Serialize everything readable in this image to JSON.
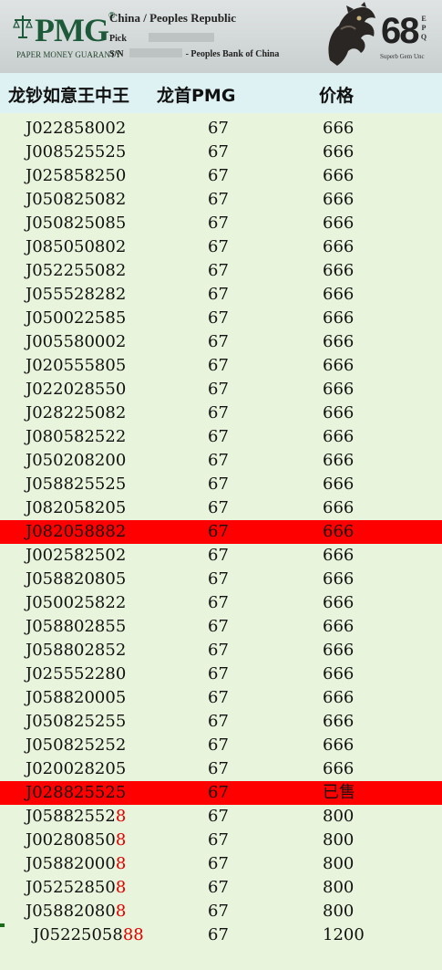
{
  "pmg": {
    "logo": "PMG",
    "tm": "®",
    "tagline": "PAPER MONEY GUARANTY",
    "country": "China / Peoples Republic",
    "pick_label": "Pick",
    "sn_label": "S/N",
    "bank": "- Peoples Bank of China",
    "grade": "68",
    "epq": [
      "E",
      "P",
      "Q"
    ],
    "grade_desc": "Superb Gem Unc"
  },
  "header": {
    "col_serial": "龙钞如意王中王",
    "col_grade": "龙首PMG",
    "col_price": "价格"
  },
  "rows": [
    {
      "serial": "J022858002",
      "suffix": "",
      "grade": "67",
      "price": "666",
      "highlight": false
    },
    {
      "serial": "J008525525",
      "suffix": "",
      "grade": "67",
      "price": "666",
      "highlight": false
    },
    {
      "serial": "J025858250",
      "suffix": "",
      "grade": "67",
      "price": "666",
      "highlight": false
    },
    {
      "serial": "J050825082",
      "suffix": "",
      "grade": "67",
      "price": "666",
      "highlight": false
    },
    {
      "serial": "J050825085",
      "suffix": "",
      "grade": "67",
      "price": "666",
      "highlight": false
    },
    {
      "serial": "J085050802",
      "suffix": "",
      "grade": "67",
      "price": "666",
      "highlight": false
    },
    {
      "serial": "J052255082",
      "suffix": "",
      "grade": "67",
      "price": "666",
      "highlight": false
    },
    {
      "serial": "J055528282",
      "suffix": "",
      "grade": "67",
      "price": "666",
      "highlight": false
    },
    {
      "serial": "J050022585",
      "suffix": "",
      "grade": "67",
      "price": "666",
      "highlight": false
    },
    {
      "serial": "J005580002",
      "suffix": "",
      "grade": "67",
      "price": "666",
      "highlight": false
    },
    {
      "serial": "J020555805",
      "suffix": "",
      "grade": "67",
      "price": "666",
      "highlight": false
    },
    {
      "serial": "J022028550",
      "suffix": "",
      "grade": "67",
      "price": "666",
      "highlight": false
    },
    {
      "serial": "J028225082",
      "suffix": "",
      "grade": "67",
      "price": "666",
      "highlight": false
    },
    {
      "serial": "J080582522",
      "suffix": "",
      "grade": "67",
      "price": "666",
      "highlight": false
    },
    {
      "serial": "J050208200",
      "suffix": "",
      "grade": "67",
      "price": "666",
      "highlight": false
    },
    {
      "serial": "J058825525",
      "suffix": "",
      "grade": "67",
      "price": "666",
      "highlight": false
    },
    {
      "serial": "J082058205",
      "suffix": "",
      "grade": "67",
      "price": "666",
      "highlight": false
    },
    {
      "serial": "J082058882",
      "suffix": "",
      "grade": "67",
      "price": "666",
      "highlight": true
    },
    {
      "serial": "J002582502",
      "suffix": "",
      "grade": "67",
      "price": "666",
      "highlight": false
    },
    {
      "serial": "J058820805",
      "suffix": "",
      "grade": "67",
      "price": "666",
      "highlight": false
    },
    {
      "serial": "J050025822",
      "suffix": "",
      "grade": "67",
      "price": "666",
      "highlight": false
    },
    {
      "serial": "J058802855",
      "suffix": "",
      "grade": "67",
      "price": "666",
      "highlight": false
    },
    {
      "serial": "J058802852",
      "suffix": "",
      "grade": "67",
      "price": "666",
      "highlight": false
    },
    {
      "serial": "J025552280",
      "suffix": "",
      "grade": "67",
      "price": "666",
      "highlight": false
    },
    {
      "serial": "J058820005",
      "suffix": "",
      "grade": "67",
      "price": "666",
      "highlight": false
    },
    {
      "serial": "J050825255",
      "suffix": "",
      "grade": "67",
      "price": "666",
      "highlight": false
    },
    {
      "serial": "J050825252",
      "suffix": "",
      "grade": "67",
      "price": "666",
      "highlight": false
    },
    {
      "serial": "J020028205",
      "suffix": "",
      "grade": "67",
      "price": "666",
      "highlight": false
    },
    {
      "serial": "J028825525",
      "suffix": "",
      "grade": "67",
      "price": "已售",
      "highlight": true
    },
    {
      "serial": "J05882552",
      "suffix": "8",
      "grade": "67",
      "price": "800",
      "highlight": false
    },
    {
      "serial": "J00280850",
      "suffix": "8",
      "grade": "67",
      "price": "800",
      "highlight": false
    },
    {
      "serial": "J05882000",
      "suffix": "8",
      "grade": "67",
      "price": "800",
      "highlight": false
    },
    {
      "serial": "J05252850",
      "suffix": "8",
      "grade": "67",
      "price": "800",
      "highlight": false
    },
    {
      "serial": "J05882080",
      "suffix": "8",
      "grade": "67",
      "price": "800",
      "highlight": false
    },
    {
      "serial": "J05225058",
      "suffix": "88",
      "grade": "67",
      "price": "1200",
      "highlight": false
    }
  ],
  "colors": {
    "background": "#e8f4dc",
    "header_bg": "#dff2f3",
    "highlight": "#ff0000",
    "suffix_red": "#e00000",
    "pmg_green": "#1d5a3a"
  }
}
